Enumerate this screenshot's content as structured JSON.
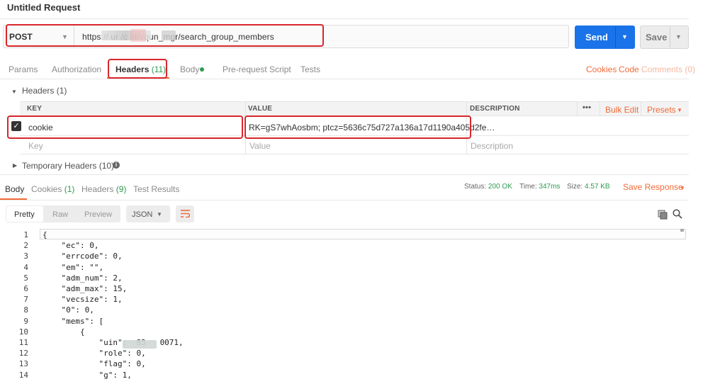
{
  "window": {
    "title": "Untitled Request"
  },
  "request": {
    "method": "POST",
    "url": "https://   ur      /c   bin/qun_mgr/search_group_members",
    "send_label": "Send",
    "save_label": "Save"
  },
  "request_tabs": {
    "params": "Params",
    "authorization": "Authorization",
    "headers": "Headers",
    "headers_count": "(11)",
    "body": "Body",
    "prerequest": "Pre-request Script",
    "tests": "Tests",
    "cookies": "Cookies",
    "code": "Code",
    "comments": "Comments (0)"
  },
  "headers_section": {
    "title": "Headers (1)",
    "columns": {
      "key": "KEY",
      "value": "VALUE",
      "description": "DESCRIPTION"
    },
    "more": "•••",
    "bulk_edit": "Bulk Edit",
    "presets": "Presets",
    "rows": [
      {
        "key": "cookie",
        "value": "RK=gS7whAosbm; ptcz=5636c75d727a136a17d1190a405d2fe…",
        "checked": true
      }
    ],
    "placeholders": {
      "key": "Key",
      "value": "Value",
      "description": "Description"
    },
    "temporary": "Temporary Headers (10)"
  },
  "response_tabs": {
    "body": "Body",
    "cookies": "Cookies",
    "cookies_count": "(1)",
    "headers": "Headers",
    "headers_count": "(9)",
    "test_results": "Test Results"
  },
  "response_meta": {
    "status_label": "Status:",
    "status_value": "200 OK",
    "time_label": "Time:",
    "time_value": "347ms",
    "size_label": "Size:",
    "size_value": "4.57 KB",
    "save_response": "Save Response"
  },
  "response_toolbar": {
    "pretty": "Pretty",
    "raw": "Raw",
    "preview": "Preview",
    "format": "JSON"
  },
  "code_lines": [
    {
      "n": "1",
      "text": "{"
    },
    {
      "n": "2",
      "text": "    \"ec\": 0,"
    },
    {
      "n": "3",
      "text": "    \"errcode\": 0,"
    },
    {
      "n": "4",
      "text": "    \"em\": \"\","
    },
    {
      "n": "5",
      "text": "    \"adm_num\": 2,"
    },
    {
      "n": "6",
      "text": "    \"adm_max\": 15,"
    },
    {
      "n": "7",
      "text": "    \"vecsize\": 1,"
    },
    {
      "n": "8",
      "text": "    \"0\": 0,"
    },
    {
      "n": "9",
      "text": "    \"mems\": ["
    },
    {
      "n": "10",
      "text": "        {"
    },
    {
      "n": "11",
      "text": "            \"uin\":  83   0071,"
    },
    {
      "n": "12",
      "text": "            \"role\": 0,"
    },
    {
      "n": "13",
      "text": "            \"flag\": 0,"
    },
    {
      "n": "14",
      "text": "            \"g\": 1,"
    }
  ],
  "colors": {
    "accent": "#f26b3a",
    "send": "#1a73e8",
    "success": "#2e9b4f",
    "highlight": "#d9262c"
  },
  "icons": [
    "caret-down-icon",
    "check-icon",
    "info-icon",
    "wrap-icon",
    "copy-icon",
    "search-icon"
  ]
}
